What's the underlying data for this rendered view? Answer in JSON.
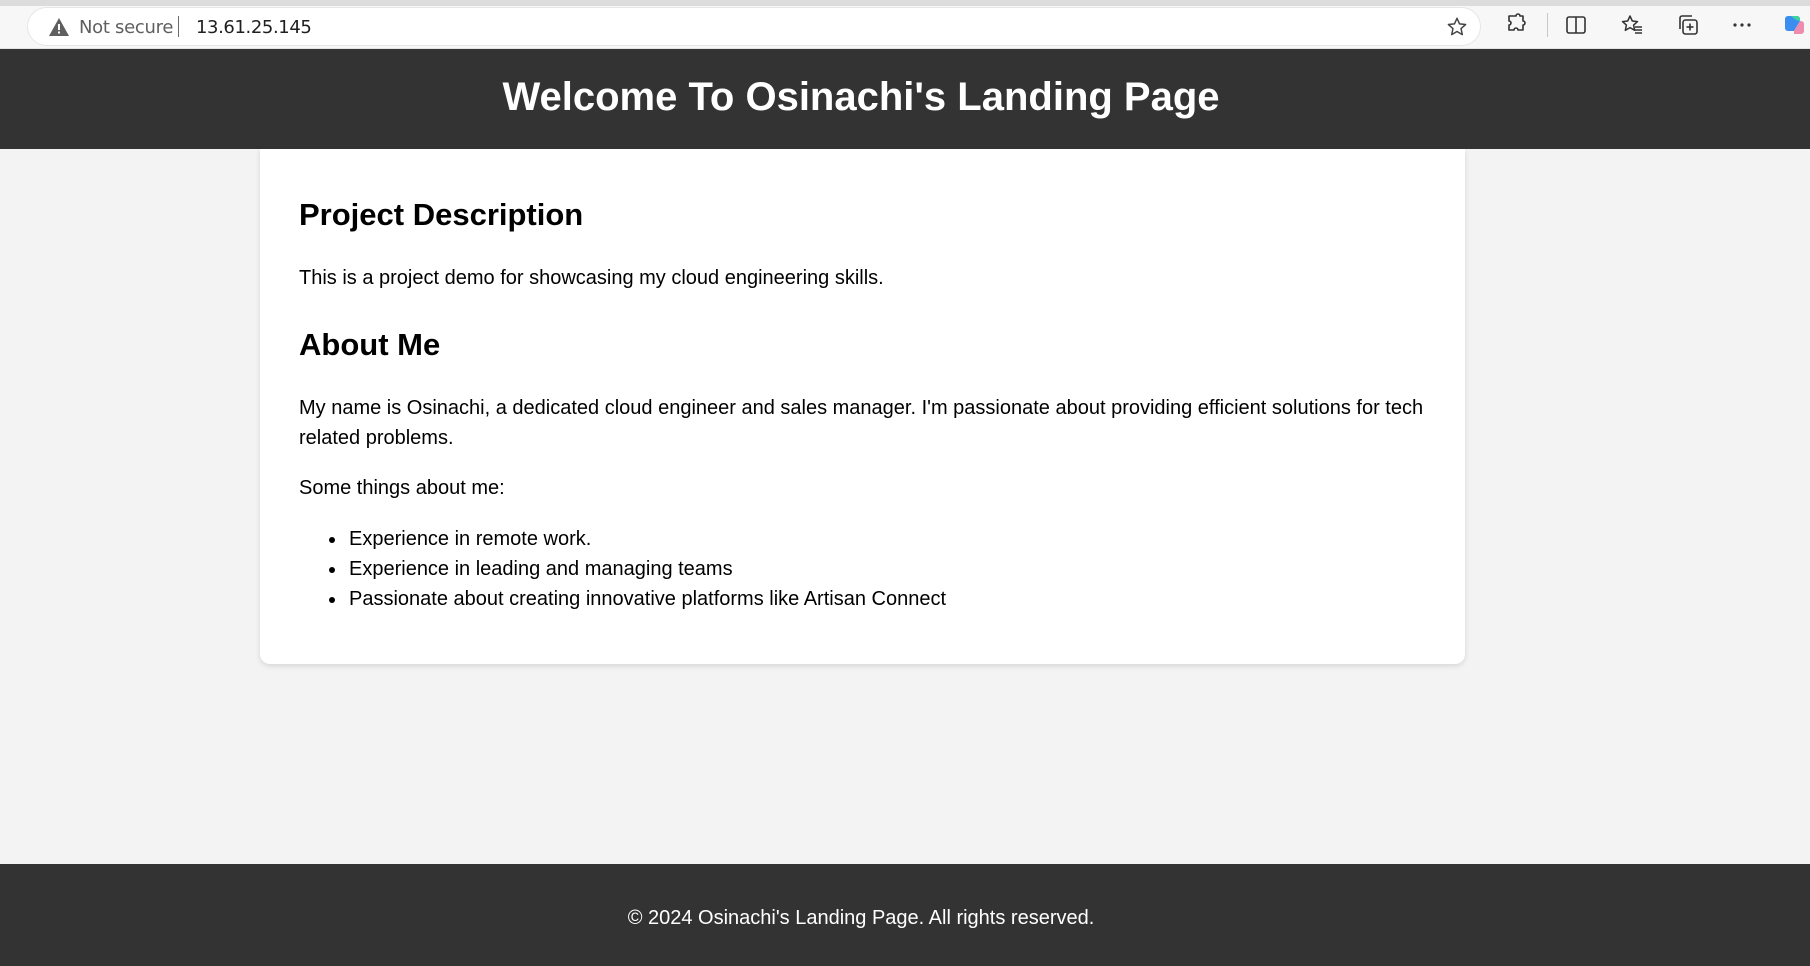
{
  "browser": {
    "security_label": "Not secure",
    "url": "13.61.25.145",
    "icons": [
      "warning-icon",
      "favorite-star-icon",
      "extensions-icon",
      "split-screen-icon",
      "favorites-icon",
      "collections-icon",
      "more-icon",
      "copilot-icon"
    ]
  },
  "header": {
    "title": "Welcome To Osinachi's Landing Page"
  },
  "main": {
    "project": {
      "heading": "Project Description",
      "text": "This is a project demo for showcasing my cloud engineering skills."
    },
    "about": {
      "heading": "About Me",
      "bio_line1": "My name is Osinachi, a dedicated cloud engineer and sales manager. I'm passionate about providing efficient solutions for tech",
      "bio_line2": "related problems.",
      "intro": "Some things about me:",
      "items": [
        "Experience in remote work.",
        "Experience in leading and managing teams",
        "Passionate about creating innovative platforms like Artisan Connect"
      ]
    }
  },
  "footer": {
    "text": "© 2024 Osinachi's Landing Page. All rights reserved."
  },
  "colors": {
    "header_bg": "#333333",
    "page_bg": "#f3f3f3",
    "card_bg": "#ffffff"
  }
}
